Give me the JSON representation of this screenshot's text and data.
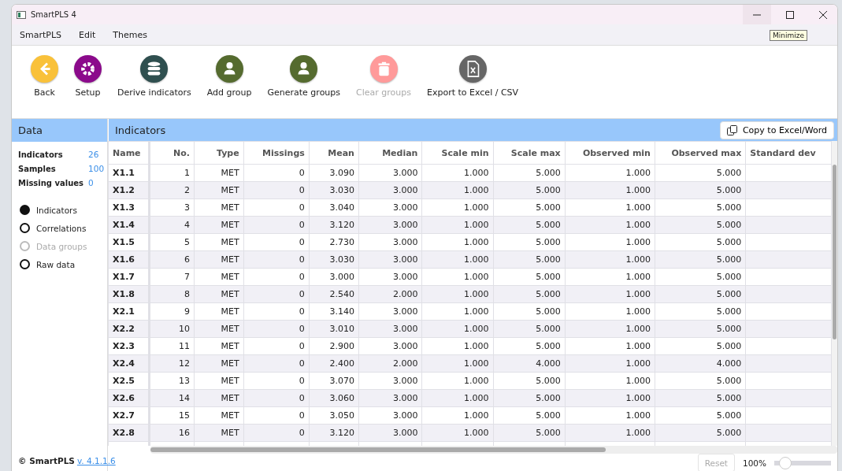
{
  "window": {
    "title": "SmartPLS 4",
    "tooltip": "Minimize"
  },
  "menu": [
    "SmartPLS",
    "Edit",
    "Themes"
  ],
  "toolbar": [
    {
      "label": "Back",
      "color": "#f9c13a",
      "disabled": false
    },
    {
      "label": "Setup",
      "color": "#8b0a8b",
      "disabled": false
    },
    {
      "label": "Derive indicators",
      "color": "#2f4f4f",
      "disabled": false
    },
    {
      "label": "Add group",
      "color": "#556b2f",
      "disabled": false
    },
    {
      "label": "Generate groups",
      "color": "#556b2f",
      "disabled": false
    },
    {
      "label": "Clear groups",
      "color": "#ff9a9a",
      "disabled": true
    },
    {
      "label": "Export to Excel / CSV",
      "color": "#666666",
      "disabled": false
    }
  ],
  "sidebar": {
    "title": "Data",
    "stats": [
      {
        "label": "Indicators",
        "value": "26"
      },
      {
        "label": "Samples",
        "value": "100"
      },
      {
        "label": "Missing values",
        "value": "0"
      }
    ],
    "views": [
      {
        "label": "Indicators",
        "selected": true,
        "disabled": false
      },
      {
        "label": "Correlations",
        "selected": false,
        "disabled": false
      },
      {
        "label": "Data groups",
        "selected": false,
        "disabled": true
      },
      {
        "label": "Raw data",
        "selected": false,
        "disabled": false
      }
    ],
    "copyright": "© SmartPLS",
    "version_link": "v. 4.1.1.6"
  },
  "panel": {
    "title": "Indicators",
    "copy_button": "Copy to Excel/Word"
  },
  "table": {
    "columns": [
      "Name",
      "No.",
      "Type",
      "Missings",
      "Mean",
      "Median",
      "Scale min",
      "Scale max",
      "Observed min",
      "Observed max",
      "Standard dev"
    ],
    "rows": [
      [
        "X1.1",
        "1",
        "MET",
        "0",
        "3.090",
        "3.000",
        "1.000",
        "5.000",
        "1.000",
        "5.000"
      ],
      [
        "X1.2",
        "2",
        "MET",
        "0",
        "3.030",
        "3.000",
        "1.000",
        "5.000",
        "1.000",
        "5.000"
      ],
      [
        "X1.3",
        "3",
        "MET",
        "0",
        "3.040",
        "3.000",
        "1.000",
        "5.000",
        "1.000",
        "5.000"
      ],
      [
        "X1.4",
        "4",
        "MET",
        "0",
        "3.120",
        "3.000",
        "1.000",
        "5.000",
        "1.000",
        "5.000"
      ],
      [
        "X1.5",
        "5",
        "MET",
        "0",
        "2.730",
        "3.000",
        "1.000",
        "5.000",
        "1.000",
        "5.000"
      ],
      [
        "X1.6",
        "6",
        "MET",
        "0",
        "3.030",
        "3.000",
        "1.000",
        "5.000",
        "1.000",
        "5.000"
      ],
      [
        "X1.7",
        "7",
        "MET",
        "0",
        "3.000",
        "3.000",
        "1.000",
        "5.000",
        "1.000",
        "5.000"
      ],
      [
        "X1.8",
        "8",
        "MET",
        "0",
        "2.540",
        "2.000",
        "1.000",
        "5.000",
        "1.000",
        "5.000"
      ],
      [
        "X2.1",
        "9",
        "MET",
        "0",
        "3.140",
        "3.000",
        "1.000",
        "5.000",
        "1.000",
        "5.000"
      ],
      [
        "X2.2",
        "10",
        "MET",
        "0",
        "3.010",
        "3.000",
        "1.000",
        "5.000",
        "1.000",
        "5.000"
      ],
      [
        "X2.3",
        "11",
        "MET",
        "0",
        "2.900",
        "3.000",
        "1.000",
        "5.000",
        "1.000",
        "5.000"
      ],
      [
        "X2.4",
        "12",
        "MET",
        "0",
        "2.400",
        "2.000",
        "1.000",
        "4.000",
        "1.000",
        "4.000"
      ],
      [
        "X2.5",
        "13",
        "MET",
        "0",
        "3.070",
        "3.000",
        "1.000",
        "5.000",
        "1.000",
        "5.000"
      ],
      [
        "X2.6",
        "14",
        "MET",
        "0",
        "3.060",
        "3.000",
        "1.000",
        "5.000",
        "1.000",
        "5.000"
      ],
      [
        "X2.7",
        "15",
        "MET",
        "0",
        "3.050",
        "3.000",
        "1.000",
        "5.000",
        "1.000",
        "5.000"
      ],
      [
        "X2.8",
        "16",
        "MET",
        "0",
        "3.120",
        "3.000",
        "1.000",
        "5.000",
        "1.000",
        "5.000"
      ]
    ]
  },
  "footer": {
    "reset_button": "Reset",
    "reset_disabled": true,
    "zoom": "100%",
    "zoom_slider": {
      "level": 0.2
    }
  }
}
